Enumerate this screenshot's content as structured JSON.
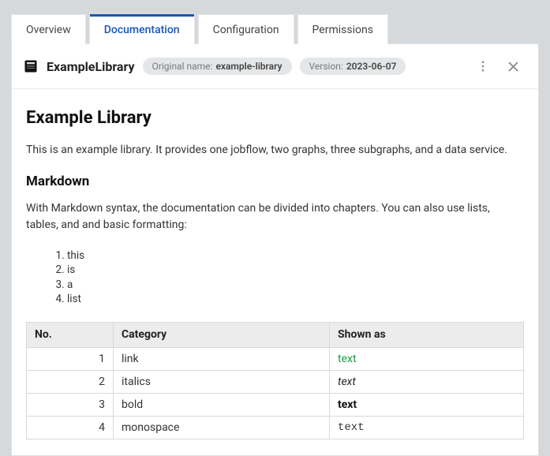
{
  "tabs": [
    {
      "label": "Overview"
    },
    {
      "label": "Documentation"
    },
    {
      "label": "Configuration"
    },
    {
      "label": "Permissions"
    }
  ],
  "header": {
    "title": "ExampleLibrary",
    "original_label": "Original name:",
    "original_value": "example-library",
    "version_label": "Version:",
    "version_value": "2023-06-07"
  },
  "doc": {
    "h1": "Example Library",
    "intro": "This is an example library. It provides one jobflow, two graphs, three subgraphs, and a data service.",
    "h2": "Markdown",
    "para2": "With Markdown syntax, the documentation can be divided into chapters. You can also use lists, tables, and and basic formatting:",
    "list": [
      "this",
      "is",
      "a",
      "list"
    ],
    "table": {
      "headers": {
        "no": "No.",
        "category": "Category",
        "shown": "Shown as"
      },
      "rows": [
        {
          "no": "1",
          "category": "link",
          "shown": "text",
          "style": "link"
        },
        {
          "no": "2",
          "category": "italics",
          "shown": "text",
          "style": "italic"
        },
        {
          "no": "3",
          "category": "bold",
          "shown": "text",
          "style": "bold"
        },
        {
          "no": "4",
          "category": "monospace",
          "shown": "text",
          "style": "mono"
        }
      ]
    }
  }
}
